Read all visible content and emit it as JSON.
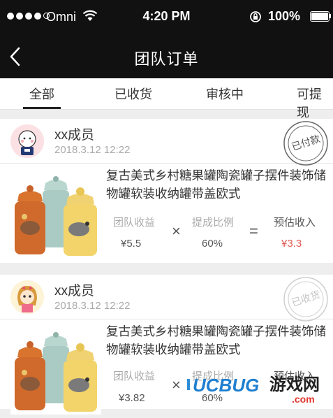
{
  "status_bar": {
    "carrier": "Omni",
    "time": "4:20 PM",
    "battery": "100%"
  },
  "nav": {
    "title": "团队订单"
  },
  "tabs": [
    {
      "label": "全部"
    },
    {
      "label": "已收货"
    },
    {
      "label": "审核中"
    },
    {
      "label": "可提现"
    }
  ],
  "orders": [
    {
      "member": "xx成员",
      "time": "2018.3.12 12:22",
      "stamp": "已付款",
      "product_title": "复古美式乡村糖果罐陶瓷罐子摆件装饰储物罐软装收纳罐带盖欧式",
      "income_label": "团队收益",
      "income": "¥5.5",
      "ratio_label": "提成比例",
      "ratio": "60%",
      "estimate_label": "预估收入",
      "estimate": "¥3.3"
    },
    {
      "member": "xx成员",
      "time": "2018.3.12 12:22",
      "stamp": "已收货",
      "product_title": "复古美式乡村糖果罐陶瓷罐子摆件装饰储物罐软装收纳罐带盖欧式",
      "income_label": "团队收益",
      "income": "¥3.82",
      "ratio_label": "提成比例",
      "ratio": "60%",
      "estimate_label": "预估收入",
      "estimate": ""
    }
  ],
  "operators": {
    "times": "×",
    "equals": "="
  },
  "watermark": {
    "brand": "UCBUG",
    "text": "游戏网",
    "domain": ".com"
  },
  "colors": {
    "accent": "#e05a54",
    "header_bg": "#111111",
    "stamp_paid": "#555555",
    "stamp_received": "#cfcfcf"
  }
}
